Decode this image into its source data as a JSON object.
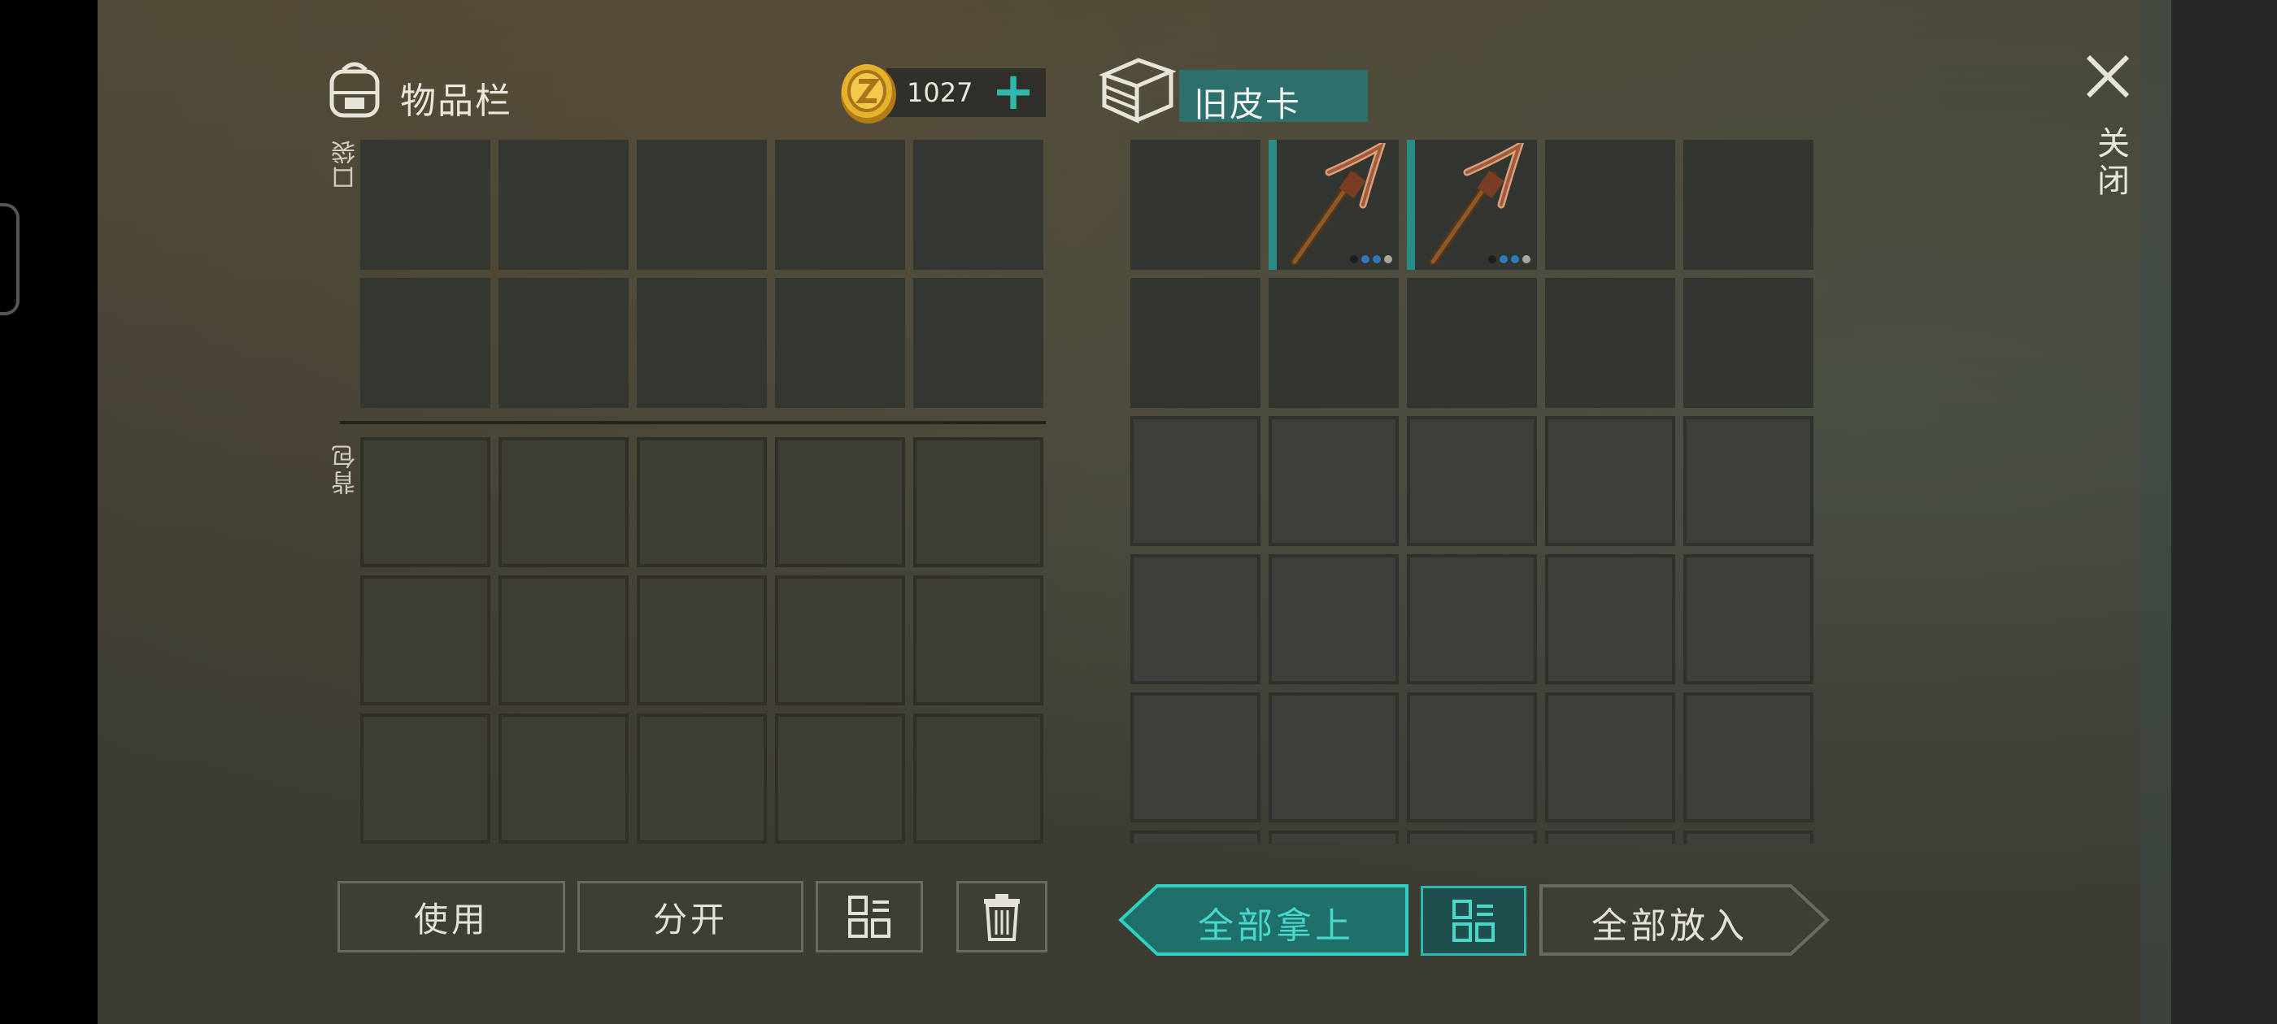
{
  "inventory": {
    "title": "物品栏",
    "pocket_label": "口袋",
    "backpack_label": "背包",
    "currency": 1027,
    "currency_add": "+"
  },
  "container": {
    "name": "旧皮卡",
    "items": [
      {
        "slot": 2,
        "name": "pickaxe-icon",
        "durability_dots": [
          "#1e1f1c",
          "#2e79b8",
          "#2e79b8",
          "#a8a8a0"
        ]
      },
      {
        "slot": 3,
        "name": "pickaxe-icon",
        "durability_dots": [
          "#1e1f1c",
          "#2e79b8",
          "#2e79b8",
          "#a8a8a0"
        ]
      }
    ]
  },
  "close": {
    "label": "关闭"
  },
  "actions": {
    "use": "使用",
    "split": "分开",
    "take_all": "全部拿上",
    "put_all": "全部放入"
  },
  "colors": {
    "accent": "#2fb8ad",
    "container_name_bg": "#2c6f6c"
  }
}
